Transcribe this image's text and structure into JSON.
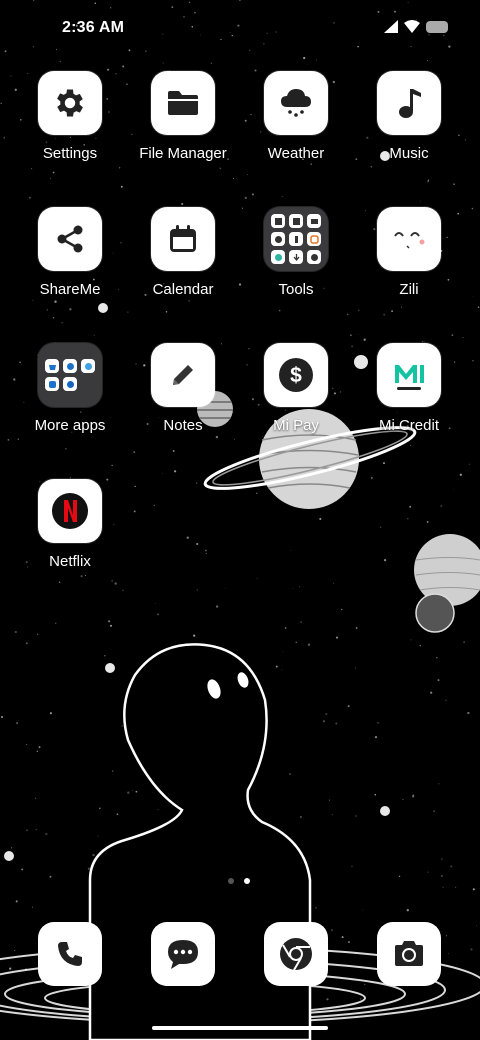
{
  "status_bar": {
    "time": "2:36 AM"
  },
  "apps": [
    {
      "label": "Settings",
      "icon": "gear-icon"
    },
    {
      "label": "File Manager",
      "icon": "folder-icon"
    },
    {
      "label": "Weather",
      "icon": "weather-cloud-icon"
    },
    {
      "label": "Music",
      "icon": "music-note-icon"
    },
    {
      "label": "ShareMe",
      "icon": "share-icon"
    },
    {
      "label": "Calendar",
      "icon": "calendar-icon"
    },
    {
      "label": "Tools",
      "icon": "tools-folder-icon"
    },
    {
      "label": "Zili",
      "icon": "zili-face-icon"
    },
    {
      "label": "More apps",
      "icon": "more-apps-folder-icon"
    },
    {
      "label": "Notes",
      "icon": "pencil-icon"
    },
    {
      "label": "Mi Pay",
      "icon": "dollar-icon"
    },
    {
      "label": "Mi Credit",
      "icon": "mi-credit-logo-icon"
    },
    {
      "label": "Netflix",
      "icon": "netflix-icon"
    }
  ],
  "dock": [
    {
      "icon": "phone-icon"
    },
    {
      "icon": "messages-icon"
    },
    {
      "icon": "chrome-icon"
    },
    {
      "icon": "camera-icon"
    }
  ],
  "pager": {
    "pages": 2,
    "current": 2
  },
  "colors": {
    "netflix_red": "#e50914",
    "mi_credit_green": "#14c3a2",
    "folder_bg": "#3a3a3c"
  }
}
